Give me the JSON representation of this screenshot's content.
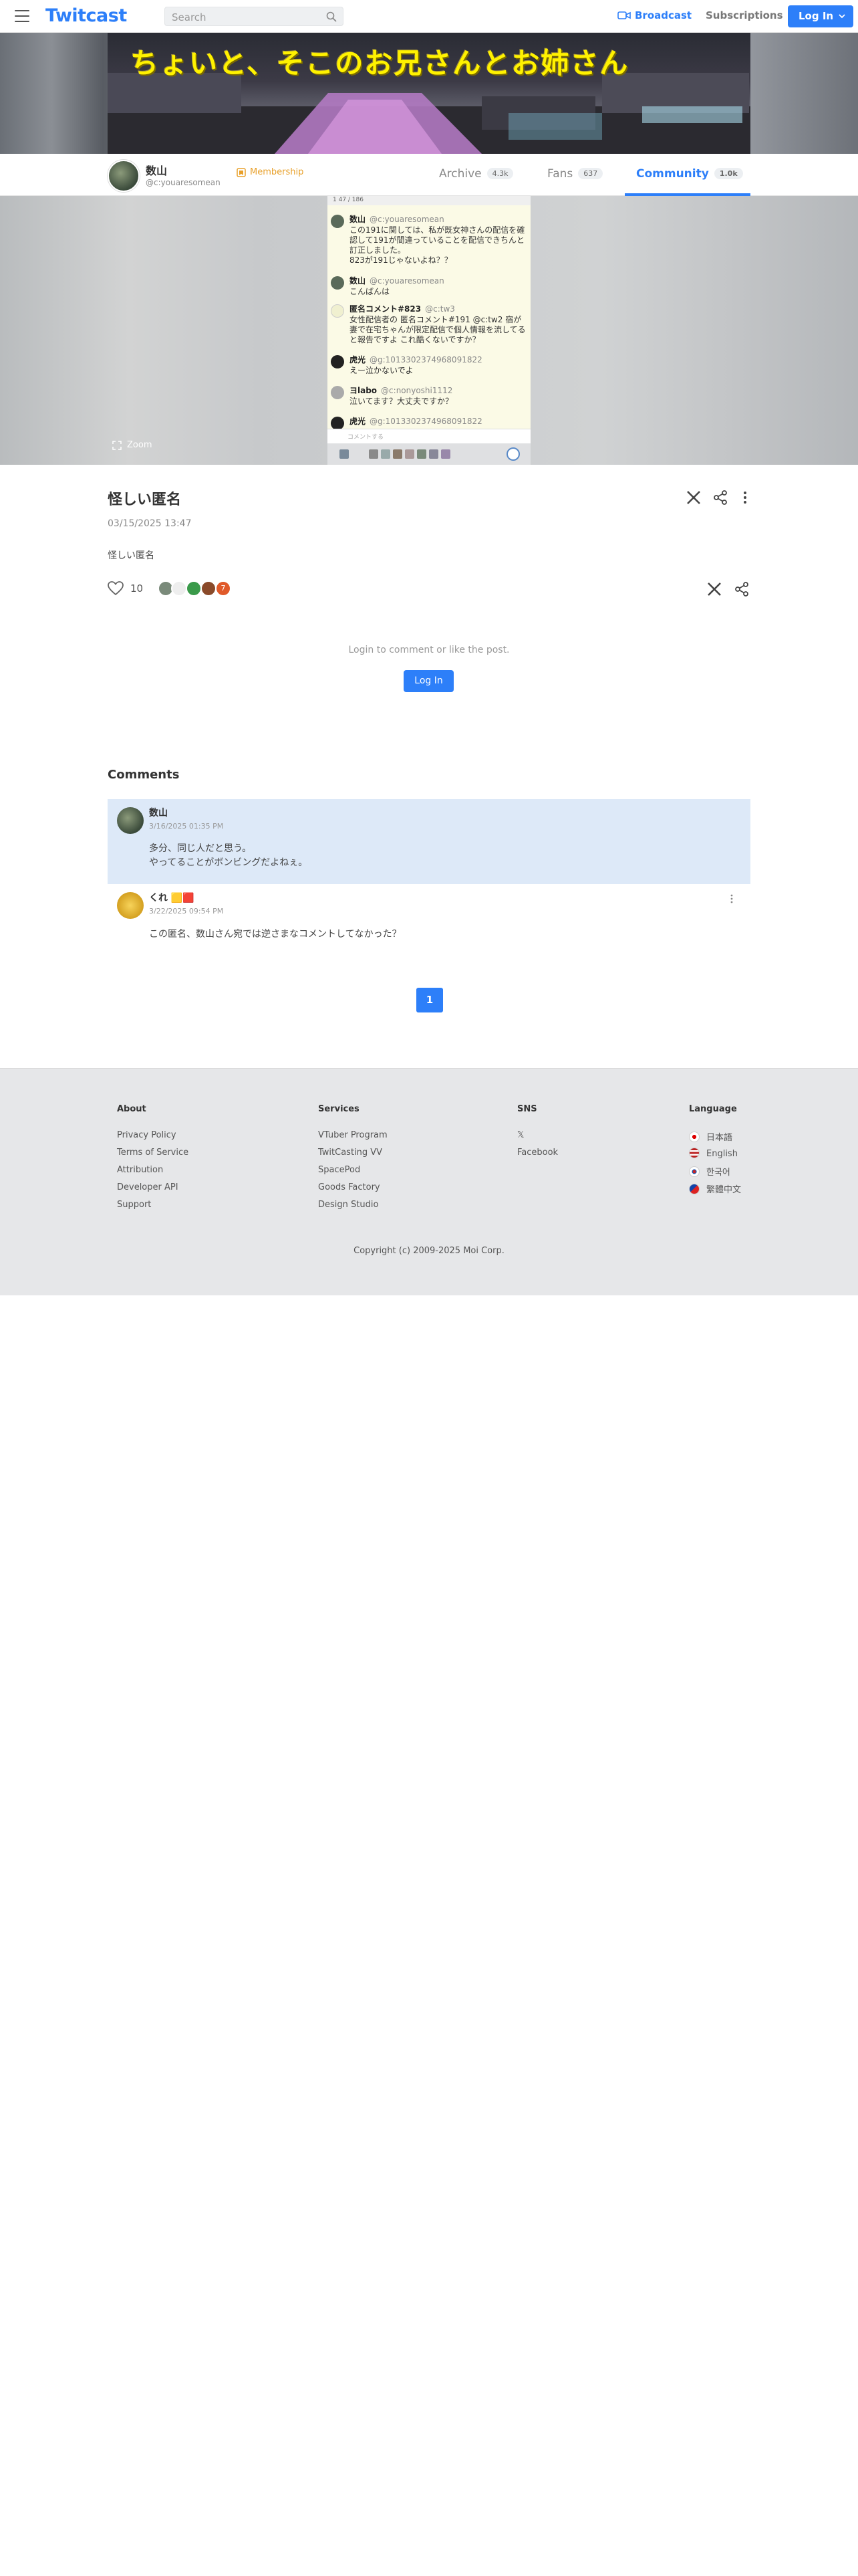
{
  "header": {
    "logo": "Twitcast",
    "search_placeholder": "Search",
    "broadcast": "Broadcast",
    "subscriptions": "Subscriptions",
    "login": "Log In"
  },
  "banner": {
    "title": "ちょいと、そこのお兄さんとお姉さん"
  },
  "profile": {
    "name": "数山",
    "id": "@c:youaresomean",
    "membership": "Membership",
    "tabs": [
      {
        "label": "Archive",
        "count": "4.3k"
      },
      {
        "label": "Fans",
        "count": "637"
      },
      {
        "label": "Community",
        "count": "1.0k"
      }
    ]
  },
  "media": {
    "zoom": "Zoom",
    "screenshot": {
      "top": "1 47 / 186",
      "comments": [
        {
          "name": "数山",
          "id": "@c:youaresomean",
          "text": "この191に関しては、私が既女神さんの配信を確認して191が間違っていることを配信できちんと訂正しました。\n823が191じゃないよね？？"
        },
        {
          "name": "数山",
          "id": "@c:youaresomean",
          "text": "こんばんは"
        },
        {
          "name": "匿名コメント#823",
          "id": "@c:tw3",
          "text": "女性配信者の 匿名コメント#191 @c:tw2 宿が妻で在宅ちゃんが限定配信で個人情報を流してると報告ですよ これ酷くないですか？"
        },
        {
          "name": "虎光",
          "id": "@g:1013302374968091822",
          "text": "えー泣かないでよ"
        },
        {
          "name": "ヨlabo",
          "id": "@c:nonyoshi1112",
          "text": "泣いてます？大丈夫ですか？"
        },
        {
          "name": "虎光",
          "id": "@g:1013302374968091822",
          "text": ""
        }
      ],
      "input_placeholder": "コメントする"
    }
  },
  "post": {
    "title": "怪しい匿名",
    "date": "03/15/2025 13:47",
    "body": "怪しい匿名",
    "likes": "10",
    "likers_more": "7",
    "login_note": "Login to comment or like the post.",
    "login_button": "Log In"
  },
  "comments": {
    "heading": "Comments",
    "items": [
      {
        "name": "数山",
        "date": "3/16/2025 01:35 PM",
        "text": "多分、同じ人だと思う。\nやってることがボンビングだよねぇ。"
      },
      {
        "name": "くれ 🟨🟥",
        "date": "3/22/2025 09:54 PM",
        "text": "この匿名、数山さん宛では逆さまなコメントしてなかった？"
      }
    ],
    "page": "1"
  },
  "footer": {
    "about": {
      "heading": "About",
      "items": [
        "Privacy Policy",
        "Terms of Service",
        "Attribution",
        "Developer API",
        "Support"
      ]
    },
    "services": {
      "heading": "Services",
      "items": [
        "VTuber Program",
        "TwitCasting VV",
        "SpacePod",
        "Goods Factory",
        "Design Studio"
      ]
    },
    "sns": {
      "heading": "SNS",
      "items": [
        "𝕏",
        "Facebook"
      ]
    },
    "language": {
      "heading": "Language",
      "items": [
        "日本語",
        "English",
        "한국어",
        "繁體中文"
      ]
    },
    "copyright": "Copyright (c) 2009-2025 Moi Corp."
  },
  "colors": {
    "accent": "#2d7ff9",
    "membership": "#e8a02a",
    "comment_highlight": "#dde9f8",
    "footer_bg": "#e6e7e9"
  }
}
